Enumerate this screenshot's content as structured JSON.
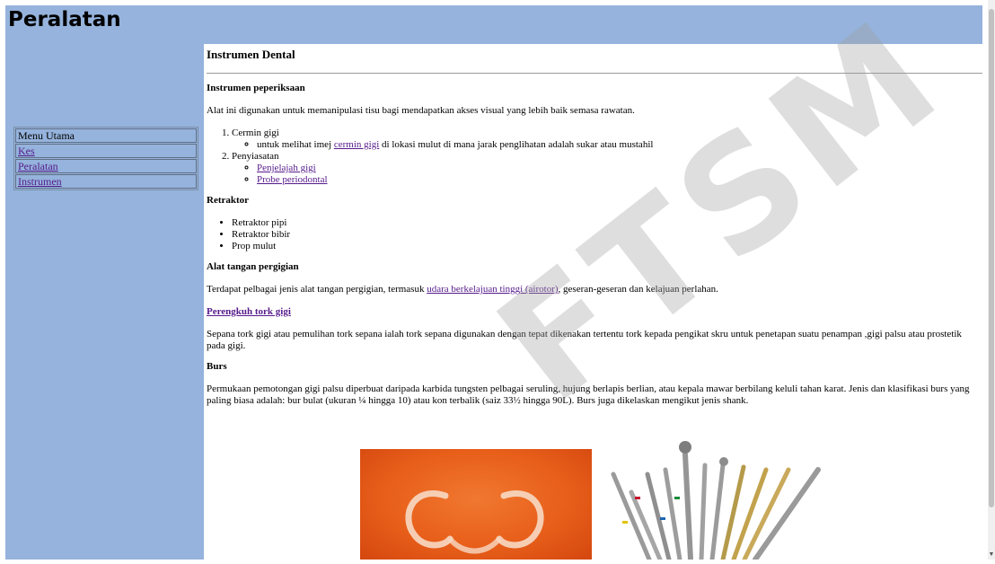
{
  "header": {
    "title": "Peralatan"
  },
  "sidebar": {
    "menu_title": "Menu Utama",
    "links": [
      "Kes",
      "Peralatan",
      "Instrumen"
    ]
  },
  "content": {
    "page_heading": "Instrumen Dental",
    "sec1_title": "Instrumen peperiksaan",
    "sec1_text": "Alat ini digunakan untuk memanipulasi tisu bagi mendapatkan akses visual yang lebih baik semasa rawatan.",
    "ol1": "Cermin gigi",
    "ol1_sub_pre": "untuk melihat imej ",
    "ol1_sub_link": "cermin gigi",
    "ol1_sub_post": " di lokasi mulut di mana jarak penglihatan adalah sukar atau mustahil",
    "ol2": "Penyiasatan",
    "ol2_sub1": "Penjelajah gigi",
    "ol2_sub2": "Probe periodontal",
    "sec2_title": "Retraktor",
    "sec2_items": [
      "Retraktor pipi",
      "Retraktor bibir",
      "Prop mulut"
    ],
    "sec3_title": "Alat tangan pergigian",
    "sec3_pre": "Terdapat pelbagai jenis alat tangan pergigian, termasuk ",
    "sec3_link": "udara berkelajuan tinggi (airotor)",
    "sec3_post": ", geseran-geseran dan kelajuan perlahan.",
    "sec4_title": "Perengkuh tork gigi",
    "sec4_text": "Sepana tork gigi atau pemulihan tork sepana ialah tork sepana digunakan dengan tepat dikenakan tertentu tork kepada pengikat skru untuk penetapan suatu penampan ,gigi palsu atau prostetik pada gigi.",
    "sec5_title": "Burs",
    "sec5_text": "Permukaan pemotongan gigi palsu diperbuat daripada karbida tungsten pelbagai seruling, hujung berlapis berlian, atau kepala mawar berbilang keluli tahan karat. Jenis dan klasifikasi burs yang paling biasa adalah: bur bulat (ukuran ¼ hingga 10) atau kon terbalik (saiz 33½ hingga 90L). Burs juga dikelaskan mengikut jenis shank."
  },
  "watermark": {
    "text": "FTSM"
  },
  "colors": {
    "header_bg": "#95b3dc",
    "link": "#551a8b"
  }
}
